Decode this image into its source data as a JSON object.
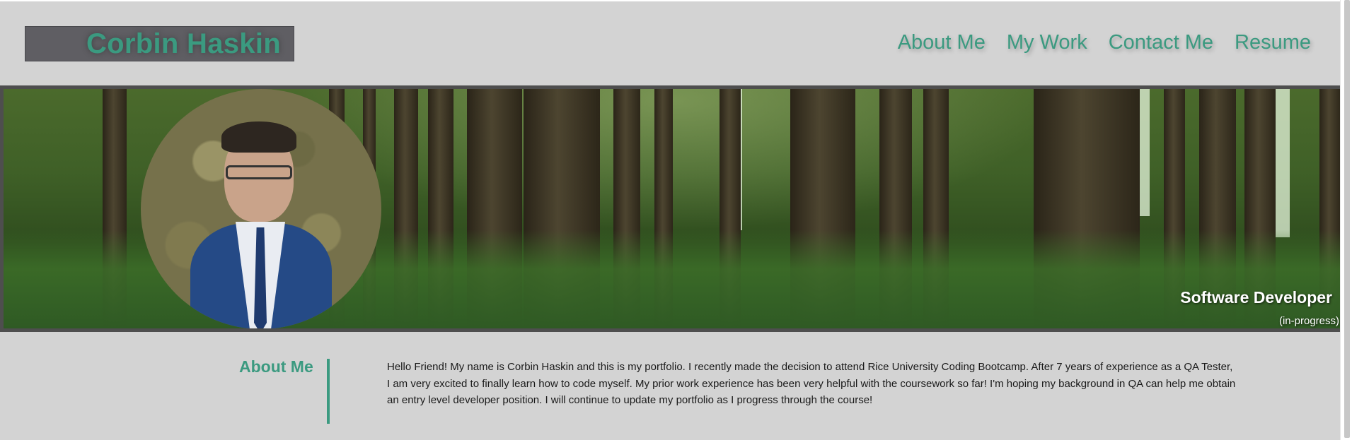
{
  "header": {
    "logo_text": "Corbin Haskin",
    "nav": [
      {
        "label": "About Me"
      },
      {
        "label": "My Work"
      },
      {
        "label": "Contact Me"
      },
      {
        "label": "Resume"
      }
    ]
  },
  "hero": {
    "title": "Software Developer",
    "subtitle": "(in-progress)"
  },
  "about": {
    "heading": "About Me",
    "body": "Hello Friend! My name is Corbin Haskin and this is my portfolio. I recently made the decision to attend Rice University Coding Bootcamp. After 7 years of experience as a QA Tester, I am very excited to finally learn how to code myself. My prior work experience has been very helpful with the coursework so far! I'm hoping my background in QA can help me obtain an entry level developer position. I will continue to update my portfolio as I progress through the course!"
  },
  "colors": {
    "accent": "#3b9a80",
    "background": "#d3d3d3",
    "logo_box": "#5f5e63"
  }
}
